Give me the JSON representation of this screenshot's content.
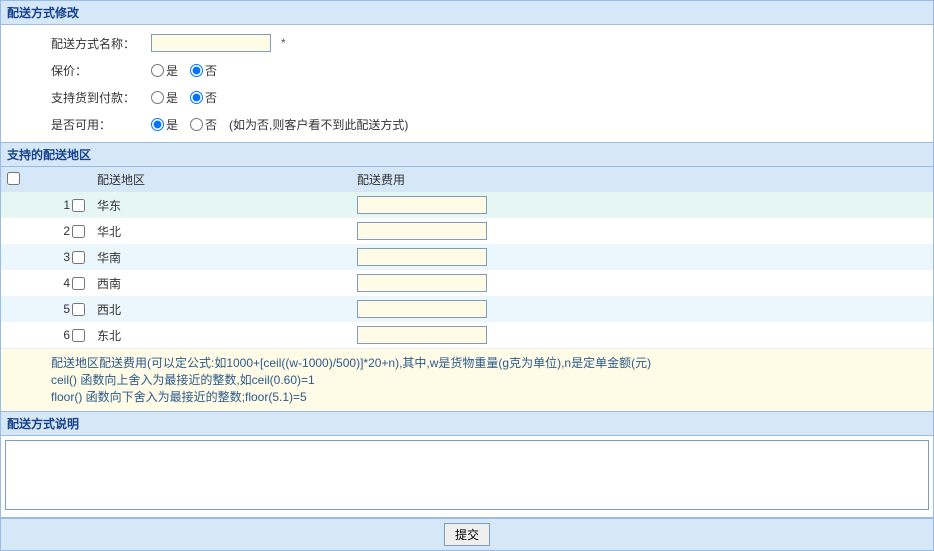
{
  "section1": {
    "title": "配送方式修改",
    "name_label": "配送方式名称：",
    "name_value": "",
    "name_asterisk": "*",
    "insured_label": "保价：",
    "cod_label": "支持货到付款：",
    "enabled_label": "是否可用：",
    "yes_label": "是",
    "no_label": "否",
    "enabled_hint": "(如为否,则客户看不到此配送方式)",
    "insured_value": "否",
    "cod_value": "否",
    "enabled_value": "是"
  },
  "section2": {
    "title": "支持的配送地区",
    "col_region": "配送地区",
    "col_fee": "配送费用",
    "regions": [
      {
        "idx": "1",
        "name": "华东",
        "fee": ""
      },
      {
        "idx": "2",
        "name": "华北",
        "fee": ""
      },
      {
        "idx": "3",
        "name": "华南",
        "fee": ""
      },
      {
        "idx": "4",
        "name": "西南",
        "fee": ""
      },
      {
        "idx": "5",
        "name": "西北",
        "fee": ""
      },
      {
        "idx": "6",
        "name": "东北",
        "fee": ""
      }
    ],
    "note_line1": "配送地区配送费用(可以定公式:如1000+[ceil((w-1000)/500)]*20+n),其中,w是货物重量(g克为单位),n是定单金额(元)",
    "note_line2": "ceil() 函数向上舍入为最接近的整数,如ceil(0.60)=1",
    "note_line3": "floor() 函数向下舍入为最接近的整数;floor(5.1)=5"
  },
  "section3": {
    "title": "配送方式说明",
    "value": ""
  },
  "submit_label": "提交"
}
